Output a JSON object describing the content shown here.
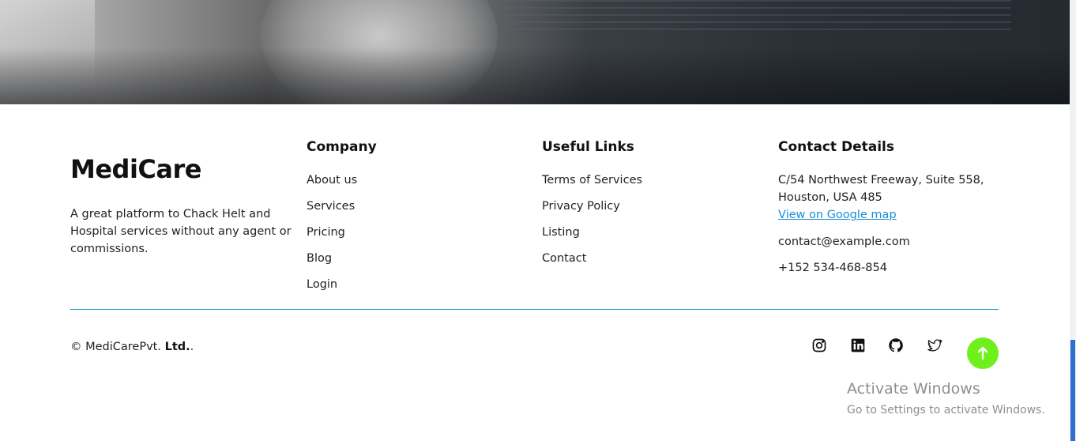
{
  "hero": {
    "icon": "doctor-photo-banner"
  },
  "brand": {
    "name": "MediCare",
    "tagline": "A great platform to Chack Helt and Hospital services without any agent or commissions."
  },
  "company": {
    "heading": "Company",
    "links": [
      "About us",
      "Services",
      "Pricing",
      "Blog",
      "Login"
    ]
  },
  "useful": {
    "heading": "Useful Links",
    "links": [
      "Terms of Services",
      "Privacy Policy",
      "Listing",
      "Contact"
    ]
  },
  "contact": {
    "heading": "Contact Details",
    "address_line1": "C/54 Northwest Freeway, Suite 558,",
    "address_line2": "Houston, USA 485",
    "map_link": "View on Google map",
    "email": "contact@example.com",
    "phone": "+152 534-468-854"
  },
  "footer": {
    "copyright_prefix": "© MediCarePvt.",
    "copyright_bold": "Ltd.",
    "copyright_suffix": ".",
    "social": [
      "instagram-icon",
      "linkedin-icon",
      "github-icon",
      "twitter-icon"
    ],
    "scroll_top_icon": "arrow-up-icon",
    "accent_color": "#6ef01a",
    "rule_color": "#1fa3c9",
    "link_color": "#1a8fd8"
  },
  "watermark": {
    "title": "Activate Windows",
    "subtitle": "Go to Settings to activate Windows."
  }
}
